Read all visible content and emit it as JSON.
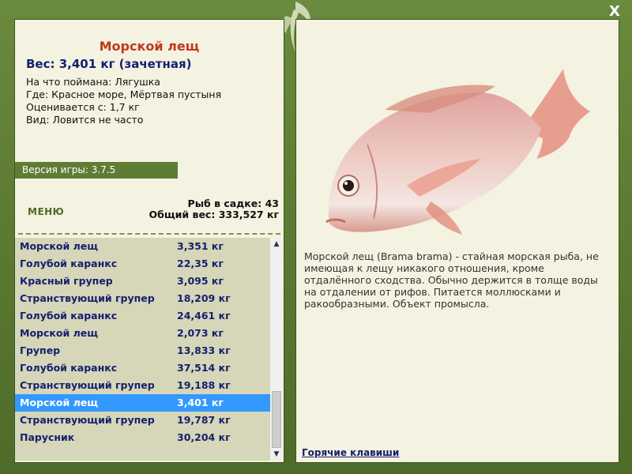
{
  "header": {
    "fish_name": "Морской лещ",
    "weight_line": "Вес: 3,401 кг (зачетная)"
  },
  "details": {
    "caught_on": "На что поймана: Лягушка",
    "location": "Где: Красное море, Мёртвая пустыня",
    "valued_from": "Оценивается с: 1,7 кг",
    "rarity": "Вид: Ловится не часто"
  },
  "version": "Версия игры: 3.7.5",
  "menu_label": "МЕНЮ",
  "stats": {
    "fish_in_keepnet": "Рыб в садке: 43",
    "total_weight": "Общий вес: 333,527 кг"
  },
  "catch_list": [
    {
      "name": "Морской лещ",
      "weight": "3,351 кг"
    },
    {
      "name": "Голубой каранкс",
      "weight": "22,35 кг"
    },
    {
      "name": "Красный групер",
      "weight": "3,095 кг"
    },
    {
      "name": "Странствующий групер",
      "weight": "18,209 кг"
    },
    {
      "name": "Голубой каранкс",
      "weight": "24,461 кг"
    },
    {
      "name": "Морской лещ",
      "weight": "2,073 кг"
    },
    {
      "name": "Групер",
      "weight": "13,833 кг"
    },
    {
      "name": "Голубой каранкс",
      "weight": "37,514 кг"
    },
    {
      "name": "Странствующий групер",
      "weight": "19,188 кг"
    },
    {
      "name": "Морской лещ",
      "weight": "3,401 кг",
      "selected": true
    },
    {
      "name": "Странствующий групер",
      "weight": "19,787 кг"
    },
    {
      "name": "Парусник",
      "weight": "30,204 кг"
    }
  ],
  "description": "Морской лещ (Brama brama) - стайная морская рыба, не имеющая к лещу никакого отношения, кроме отдалённого сходства. Обычно держится в толще воды на отдалении от рифов. Питается моллюсками и ракообразными. Объект промысла.",
  "hotkeys_label": "Горячие клавиши",
  "close_label": "X",
  "icons": {
    "close": "close-icon",
    "leaf": "leaf-icon",
    "scroll_up": "chevron-up-icon",
    "scroll_down": "chevron-down-icon"
  },
  "colors": {
    "frame_green": "#5b7a34",
    "panel_bg": "#f4f2e0",
    "list_bg": "#d6d6b8",
    "selected_row": "#3399ff",
    "fish_title": "#c0391b",
    "list_text": "#14206e"
  }
}
